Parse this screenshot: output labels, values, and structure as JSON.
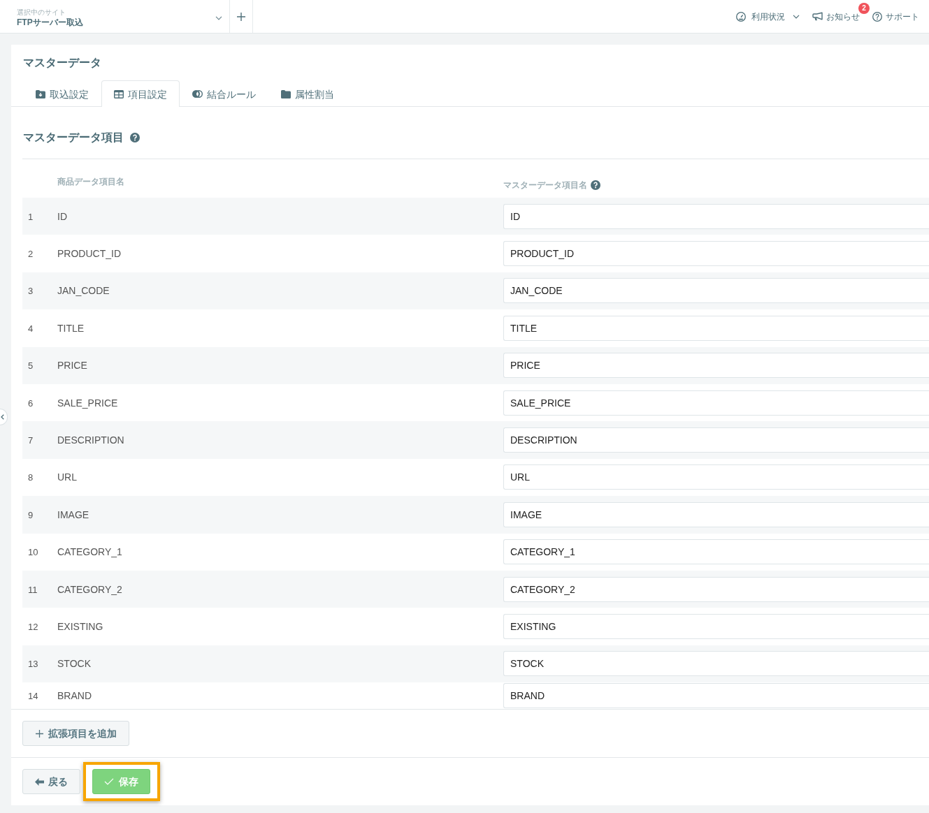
{
  "header": {
    "site_selector": {
      "label": "選択中のサイト",
      "value": "FTPサーバー取込"
    },
    "nav": [
      {
        "kind": "menu",
        "label": "利用状況"
      },
      {
        "kind": "notice",
        "label": "お知らせ",
        "badge": "2"
      },
      {
        "kind": "help",
        "label": "サポート"
      }
    ]
  },
  "page": {
    "title": "マスターデータ",
    "tabs": [
      {
        "label": "取込設定",
        "selected": false
      },
      {
        "label": "項目設定",
        "selected": true
      },
      {
        "label": "結合ルール",
        "selected": false
      },
      {
        "label": "属性割当",
        "selected": false
      }
    ],
    "section_title": "マスターデータ項目"
  },
  "table": {
    "columns": [
      "商品データ項目名",
      "マスターデータ項目名"
    ],
    "rows": [
      {
        "number": "1",
        "source_name": "ID",
        "master_name": "ID"
      },
      {
        "number": "2",
        "source_name": "PRODUCT_ID",
        "master_name": "PRODUCT_ID"
      },
      {
        "number": "3",
        "source_name": "JAN_CODE",
        "master_name": "JAN_CODE"
      },
      {
        "number": "4",
        "source_name": "TITLE",
        "master_name": "TITLE"
      },
      {
        "number": "5",
        "source_name": "PRICE",
        "master_name": "PRICE"
      },
      {
        "number": "6",
        "source_name": "SALE_PRICE",
        "master_name": "SALE_PRICE"
      },
      {
        "number": "7",
        "source_name": "DESCRIPTION",
        "master_name": "DESCRIPTION"
      },
      {
        "number": "8",
        "source_name": "URL",
        "master_name": "URL"
      },
      {
        "number": "9",
        "source_name": "IMAGE",
        "master_name": "IMAGE"
      },
      {
        "number": "10",
        "source_name": "CATEGORY_1",
        "master_name": "CATEGORY_1"
      },
      {
        "number": "11",
        "source_name": "CATEGORY_2",
        "master_name": "CATEGORY_2"
      },
      {
        "number": "12",
        "source_name": "EXISTING",
        "master_name": "EXISTING"
      },
      {
        "number": "13",
        "source_name": "STOCK",
        "master_name": "STOCK"
      },
      {
        "number": "14",
        "source_name": "BRAND",
        "master_name": "BRAND"
      }
    ]
  },
  "actions": {
    "add_button": "拡張項目を追加",
    "back_button": "戻る",
    "save_button": {
      "label": "保存",
      "highlighted": true
    }
  }
}
